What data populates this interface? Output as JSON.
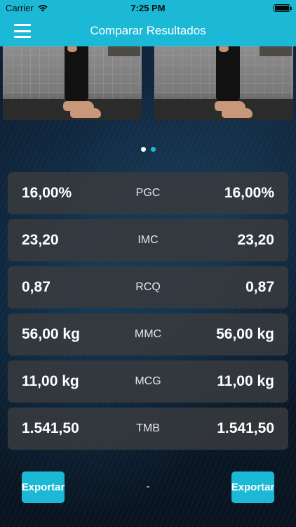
{
  "status_bar": {
    "carrier": "Carrier",
    "time": "7:25 PM"
  },
  "nav": {
    "title": "Comparar Resultados",
    "menu_icon": "hamburger-menu-icon"
  },
  "pager": {
    "total": 2,
    "active": 1
  },
  "metrics": [
    {
      "left": "16,00%",
      "label": "PGC",
      "right": "16,00%"
    },
    {
      "left": "23,20",
      "label": "IMC",
      "right": "23,20"
    },
    {
      "left": "0,87",
      "label": "RCQ",
      "right": "0,87"
    },
    {
      "left": "56,00 kg",
      "label": "MMC",
      "right": "56,00 kg"
    },
    {
      "left": "11,00 kg",
      "label": "MCG",
      "right": "11,00 kg"
    },
    {
      "left": "1.541,50",
      "label": "TMB",
      "right": "1.541,50"
    }
  ],
  "footer": {
    "export_left": "Exportar",
    "middle": "-",
    "export_right": "Exportar"
  },
  "colors": {
    "accent": "#1bb9d6",
    "row_bg": "#373a3e",
    "background": "#0b1320"
  }
}
